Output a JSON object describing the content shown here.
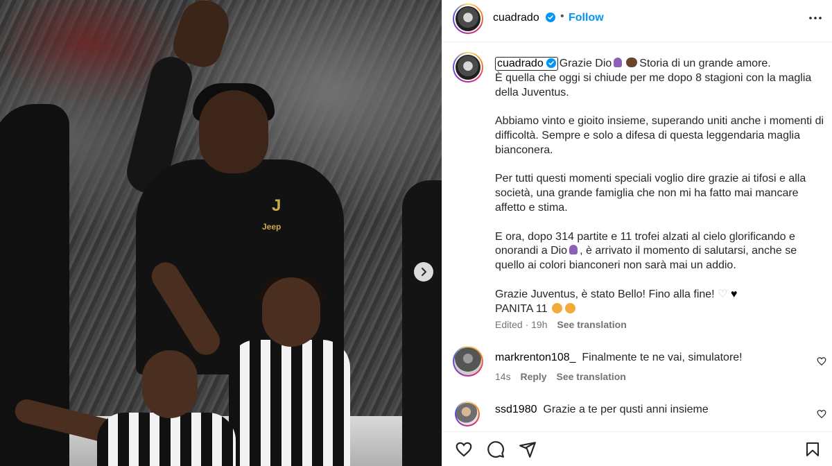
{
  "post": {
    "header": {
      "username": "cuadrado",
      "separator": "•",
      "follow_label": "Follow"
    },
    "caption": {
      "username": "cuadrado",
      "line1": "Grazie Dio",
      "line1b": "Storia di un grande amore.",
      "line2": "È quella che oggi si chiude per me dopo 8 stagioni con la maglia della Juventus.",
      "para2": "Abbiamo vinto e gioito insieme, superando uniti anche i momenti di difficoltà. Sempre e solo a difesa di questa leggendaria maglia bianconera.",
      "para3": "Per tutti questi momenti speciali voglio dire grazie ai tifosi e alla società, una grande famiglia che non mi ha fatto mai mancare affetto e stima.",
      "para4a": "E ora, dopo 314 partite e 11 trofei alzati al cielo glorificando e onorandi a Dio",
      "para4b": ", è arrivato il momento di salutarsi, anche se quello ai colori bianconeri non sarà mai un addio.",
      "para5a": "Grazie Juventus, è stato Bello! Fino alla fine!",
      "para5b": "PANITA 11",
      "edited": "Edited · 19h",
      "see_translation": "See translation"
    },
    "comments": [
      {
        "username": "markrenton108_",
        "text": "Finalmente te ne vai, simulatore!",
        "time": "14s",
        "reply": "Reply",
        "see_translation": "See translation"
      },
      {
        "username": "ssd1980",
        "text": "Grazie a te per qusti anni insieme"
      }
    ],
    "photo_text": {
      "jersey_logo": "J",
      "sponsor": "Jeep"
    }
  },
  "icons": {
    "verified": "verified-badge-icon",
    "more": "more-options-icon",
    "next": "chevron-right-icon",
    "like": "heart-icon",
    "comment": "comment-icon",
    "share": "share-icon",
    "save": "bookmark-icon"
  },
  "colors": {
    "accent": "#0095f6",
    "text": "#262626",
    "muted": "#737373",
    "divider": "#efefef"
  }
}
